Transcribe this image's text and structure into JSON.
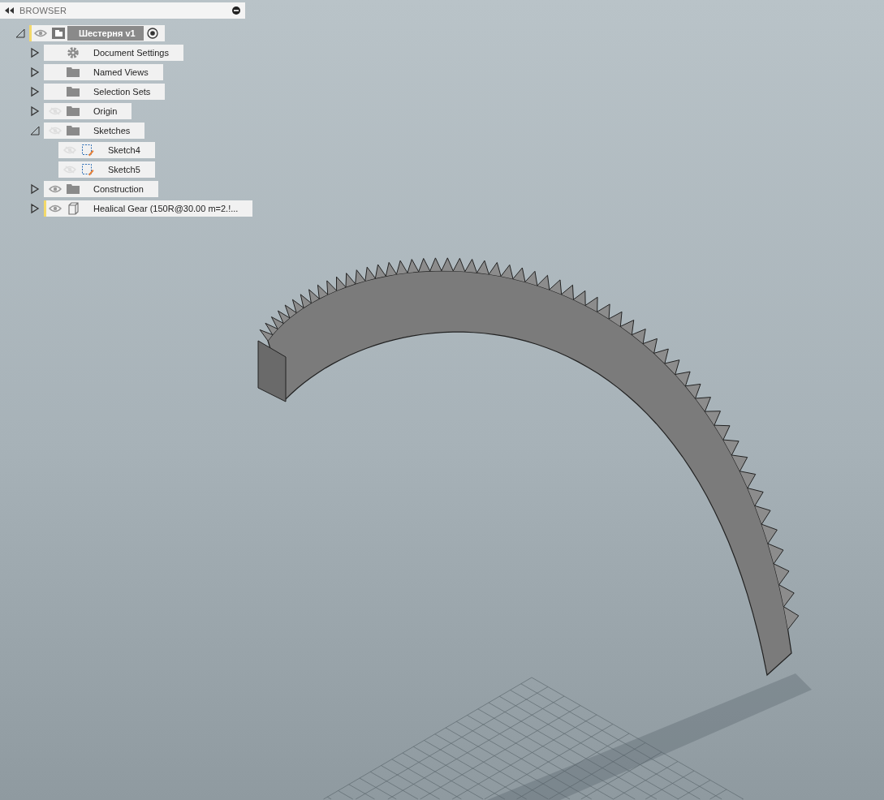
{
  "browser": {
    "title": "BROWSER",
    "root": {
      "label": "Шестерня v1",
      "kind": "component",
      "expanded": true,
      "visible": true,
      "active": true,
      "children": [
        {
          "label": "Document Settings",
          "kind": "settings",
          "expanded": false
        },
        {
          "label": "Named Views",
          "kind": "folder",
          "expanded": false
        },
        {
          "label": "Selection Sets",
          "kind": "folder",
          "expanded": false
        },
        {
          "label": "Origin",
          "kind": "folder",
          "expanded": false,
          "visible": false
        },
        {
          "label": "Sketches",
          "kind": "folder",
          "expanded": true,
          "visible": false,
          "children": [
            {
              "label": "Sketch4",
              "kind": "sketch",
              "visible": false
            },
            {
              "label": "Sketch5",
              "kind": "sketch",
              "visible": false
            }
          ]
        },
        {
          "label": "Construction",
          "kind": "folder",
          "expanded": false,
          "visible": true
        },
        {
          "label": "Healical Gear (150R@30.00 m=2.!...",
          "kind": "body",
          "expanded": false,
          "visible": true,
          "active": true
        }
      ]
    }
  }
}
